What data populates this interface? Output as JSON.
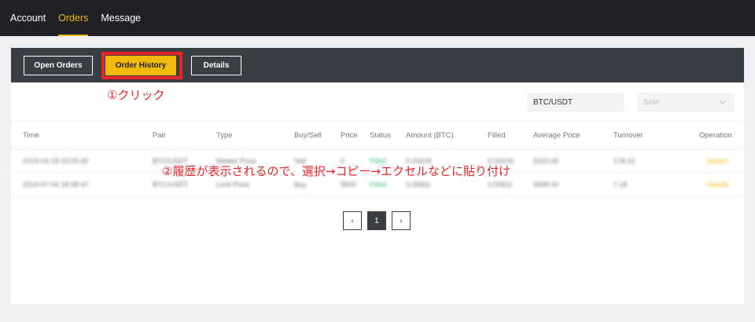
{
  "nav": {
    "items": [
      {
        "label": "Account"
      },
      {
        "label": "Orders"
      },
      {
        "label": "Message"
      }
    ]
  },
  "tabs": {
    "open_orders": "Open Orders",
    "order_history": "Order History",
    "details": "Details"
  },
  "annotations": {
    "step1": "①クリック",
    "step2": "②履歴が表示されるので、選択→コピー→エクセルなどに貼り付け"
  },
  "filters": {
    "pair": "BTC/USDT",
    "side_placeholder": "Side"
  },
  "table": {
    "columns": [
      "Time",
      "Pair",
      "Type",
      "Buy/Sell",
      "Price",
      "Status",
      "Amount (BTC)",
      "Filled",
      "Average Price",
      "Turnover",
      "Operation"
    ],
    "rows": [
      [
        "2019-04-18 23:05:40",
        "BTC/USDT",
        "Market Price",
        "Sell",
        "0",
        "Filled",
        "0.03418",
        "0.03418",
        "5210.66",
        "178.10",
        "Details"
      ],
      [
        "2019-07-04 18:38:47",
        "BTC/USDT",
        "Limit Price",
        "Buy",
        "9500",
        "Filled",
        "0.00811",
        "0.00811",
        "9508.00",
        "7.18",
        "Details"
      ]
    ]
  },
  "pagination": {
    "prev": "‹",
    "current": "1",
    "next": "›"
  },
  "colors": {
    "accent": "#f0b90b",
    "annotation": "#e8262a",
    "nav_bg": "#1f2126",
    "tab_bg": "#3b3d45",
    "status_filled": "#2fbf71"
  }
}
